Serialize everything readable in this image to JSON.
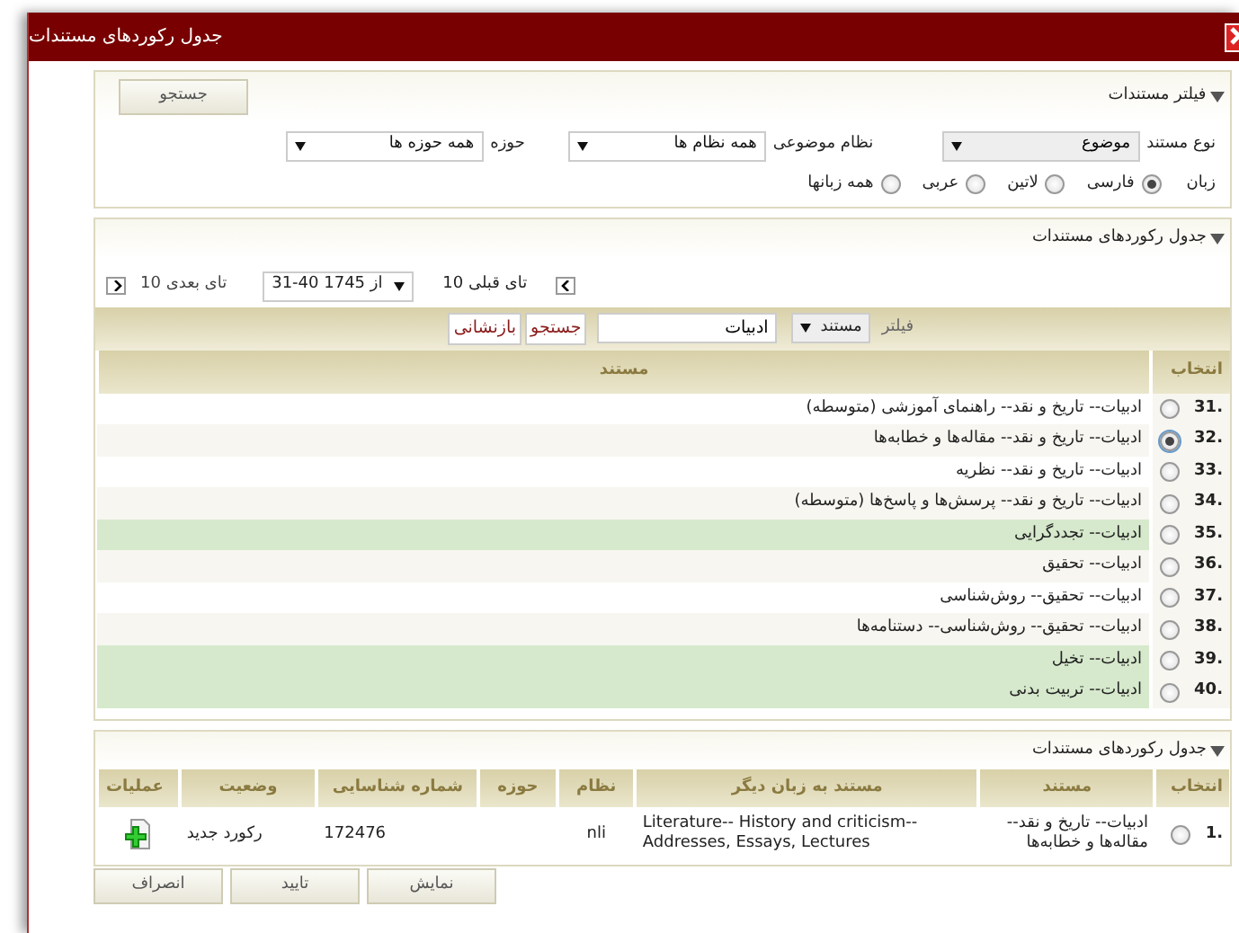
{
  "window": {
    "title": "جدول رکوردهای مستندات"
  },
  "filter_panel": {
    "title": "فیلتر مستندات",
    "expanded": true,
    "search_button": "جستجو",
    "fields": [
      {
        "label": "نوع مستند",
        "value": "موضوع",
        "disabled": true
      },
      {
        "label": "نظام موضوعی",
        "value": "همه نظام ها",
        "disabled": false
      },
      {
        "label": "حوزه",
        "value": "همه حوزه ها",
        "disabled": false
      }
    ],
    "language_label": "زبان",
    "languages": [
      {
        "label": "فارسی",
        "selected": true
      },
      {
        "label": "لاتین",
        "selected": false
      },
      {
        "label": "عربی",
        "selected": false
      },
      {
        "label": "همه زبانها",
        "selected": false
      }
    ]
  },
  "records_panel": {
    "title": "جدول رکوردهای مستندات",
    "expanded": true,
    "pager": {
      "previous": "10 تای قبلی",
      "range": "31-40 از 1745",
      "next": "10 تای بعدی"
    },
    "filter": {
      "label": "فیلتر",
      "field": "مستند",
      "value": "ادبیات",
      "search_button": "جستجو",
      "reset_button": "بازنشانی"
    },
    "columns": [
      "انتخاب",
      "مستند"
    ],
    "rows": [
      {
        "number": ".31",
        "text": "ادبیات-- تاریخ و نقد-- راهنمای آموزشی (متوسطه)",
        "selected": false,
        "color": "#ffffff"
      },
      {
        "number": ".32",
        "text": "ادبیات-- تاریخ و نقد-- مقاله‌ها و خطابه‌ها",
        "selected": true,
        "color": "#f7f6f0"
      },
      {
        "number": ".33",
        "text": "ادبیات-- تاریخ و نقد-- نظریه",
        "selected": false,
        "color": "#ffffff"
      },
      {
        "number": ".34",
        "text": "ادبیات-- تاریخ و نقد-- پرسش‌ها و پاسخ‌ها (متوسطه)",
        "selected": false,
        "color": "#f7f6f0"
      },
      {
        "number": ".35",
        "text": "ادبیات-- تجددگرایی",
        "selected": false,
        "color": "#d6e9cc"
      },
      {
        "number": ".36",
        "text": "ادبیات-- تحقیق",
        "selected": false,
        "color": "#f7f6f0"
      },
      {
        "number": ".37",
        "text": "ادبیات-- تحقیق-- روش‌شناسی",
        "selected": false,
        "color": "#ffffff"
      },
      {
        "number": ".38",
        "text": "ادبیات-- تحقیق-- روش‌شناسی-- دستنامه‌ها",
        "selected": false,
        "color": "#f7f6f0"
      },
      {
        "number": ".39",
        "text": "ادبیات-- تخیل",
        "selected": false,
        "color": "#d6e9cc"
      },
      {
        "number": ".40",
        "text": "ادبیات-- تربیت بدنی",
        "selected": false,
        "color": "#d6e9cc"
      }
    ]
  },
  "selected_panel": {
    "title": "جدول رکوردهای مستندات",
    "expanded": true,
    "columns": [
      "انتخاب",
      "مستند",
      "مستند به زبان دیگر",
      "نظام",
      "حوزه",
      "شماره شناسایی",
      "وضعیت",
      "عملیات"
    ],
    "rows": [
      {
        "number": ".1",
        "selected": false,
        "heading": "ادبیات-- تاریخ و نقد-- مقاله‌ها و خطابه‌ها",
        "other_language": "Literature-- History and criticism-- Addresses, Essays, Lectures",
        "system": "nli",
        "id": "172476",
        "status": "رکورد جدید"
      }
    ]
  },
  "buttons": [
    "نمایش",
    "تایید",
    "انصراف"
  ]
}
